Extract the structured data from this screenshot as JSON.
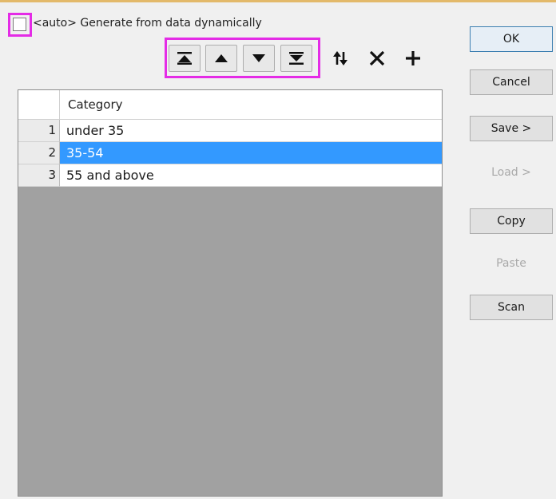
{
  "auto_checkbox": {
    "label": "<auto> Generate from data dynamically",
    "checked": false
  },
  "toolbar": {
    "move_to_top": "move-top-icon",
    "move_up": "move-up-icon",
    "move_down": "move-down-icon",
    "move_to_bottom": "move-bottom-icon",
    "reverse": "reverse-order-icon",
    "delete": "delete-icon",
    "add": "add-icon"
  },
  "grid": {
    "column_header": "Category",
    "rows": [
      {
        "num": "1",
        "value": "under 35",
        "selected": false
      },
      {
        "num": "2",
        "value": "35-54",
        "selected": true
      },
      {
        "num": "3",
        "value": "55 and above",
        "selected": false
      }
    ]
  },
  "buttons": {
    "ok": "OK",
    "cancel": "Cancel",
    "save": "Save >",
    "load": "Load >",
    "copy": "Copy",
    "paste": "Paste",
    "scan": "Scan"
  },
  "colors": {
    "selection": "#3399ff",
    "highlight": "#e42ce6",
    "grid_background": "#a1a1a1"
  }
}
